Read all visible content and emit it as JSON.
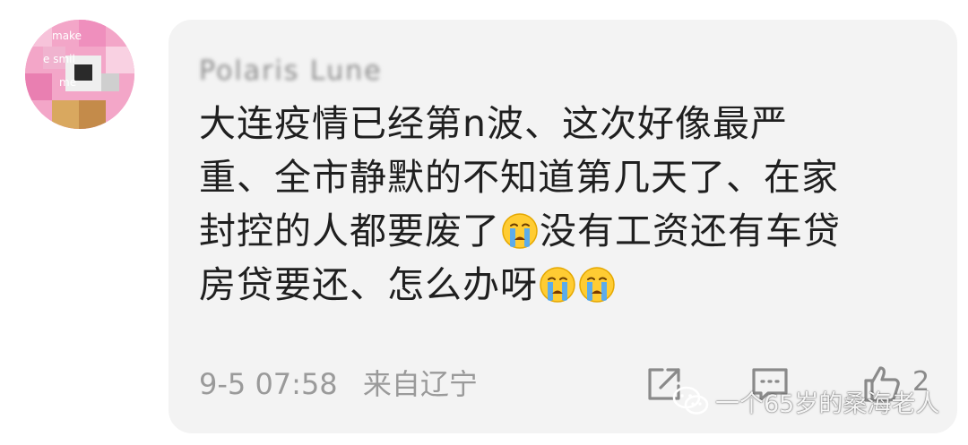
{
  "comment": {
    "username": "Polaris Lune",
    "lines": [
      [
        {
          "t": "大连疫情已经第n波、这次好像最严"
        }
      ],
      [
        {
          "t": "重、全市静默的不知道第几天了、在家"
        }
      ],
      [
        {
          "t": "封控的人都要废了"
        },
        {
          "emoji": "crying-face"
        },
        {
          "t": "没有工资还有车贷"
        }
      ],
      [
        {
          "t": "房贷要还、怎么办呀"
        },
        {
          "emoji": "crying-face"
        },
        {
          "emoji": "crying-face"
        }
      ]
    ],
    "time": "9-5 07:58",
    "location": "来自辽宁",
    "like_count": "2"
  },
  "avatar_text": [
    "make",
    "e smil",
    "me"
  ],
  "watermark": {
    "text": "一个65岁的桑海老人"
  },
  "colors": {
    "card_bg": "#f3f3f3",
    "text": "#1f1f1f",
    "meta": "#9a9a9a",
    "avatar_bg": "#f3a6c8"
  },
  "icons": [
    "share-icon",
    "comment-icon",
    "like-icon",
    "wechat-icon",
    "crying-face-emoji"
  ]
}
